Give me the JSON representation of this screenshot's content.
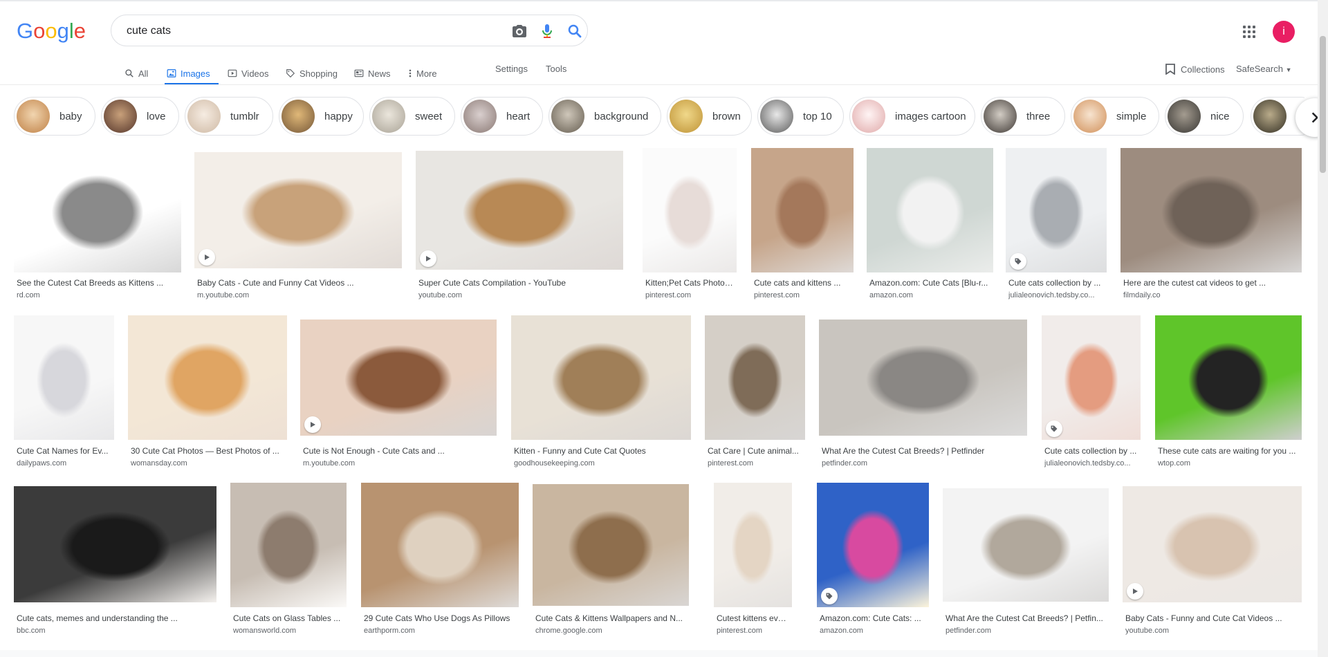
{
  "search": {
    "query": "cute cats",
    "placeholder": ""
  },
  "logo_text": "Google",
  "avatar_letter": "i",
  "tabs": [
    {
      "label": "All",
      "icon": "search-icon"
    },
    {
      "label": "Images",
      "icon": "image-icon"
    },
    {
      "label": "Videos",
      "icon": "video-icon"
    },
    {
      "label": "Shopping",
      "icon": "tag-icon"
    },
    {
      "label": "News",
      "icon": "news-icon"
    },
    {
      "label": "More",
      "icon": "more-vert-icon"
    }
  ],
  "tools": {
    "settings": "Settings",
    "tools": "Tools",
    "collections": "Collections",
    "safesearch": "SafeSearch"
  },
  "chips": [
    "baby",
    "love",
    "tumblr",
    "happy",
    "sweet",
    "heart",
    "background",
    "brown",
    "top 10",
    "images cartoon",
    "three",
    "simple",
    "nice"
  ],
  "results_row1": [
    {
      "title": "See the Cutest Cat Breeds as Kittens ...",
      "source": "rd.com"
    },
    {
      "title": "Baby Cats - Cute and Funny Cat Videos ...",
      "source": "m.youtube.com"
    },
    {
      "title": "Super Cute Cats Compilation - YouTube",
      "source": "youtube.com"
    },
    {
      "title": "Kitten;Pet Cats Photogr...",
      "source": "pinterest.com"
    },
    {
      "title": "Cute cats and kittens ...",
      "source": "pinterest.com"
    },
    {
      "title": "Amazon.com: Cute Cats [Blu-r...",
      "source": "amazon.com"
    },
    {
      "title": "Cute cats collection by ...",
      "source": "julialeonovich.tedsby.co..."
    },
    {
      "title": "Here are the cutest cat videos to get ...",
      "source": "filmdaily.co"
    }
  ],
  "results_row2": [
    {
      "title": "Cute Cat Names for Ev...",
      "source": "dailypaws.com"
    },
    {
      "title": "30 Cute Cat Photos — Best Photos of ...",
      "source": "womansday.com"
    },
    {
      "title": "Cute is Not Enough - Cute Cats and ...",
      "source": "m.youtube.com"
    },
    {
      "title": "Kitten - Funny and Cute Cat Quotes",
      "source": "goodhousekeeping.com"
    },
    {
      "title": "Cat Care | Cute animal...",
      "source": "pinterest.com"
    },
    {
      "title": "What Are the Cutest Cat Breeds? | Petfinder",
      "source": "petfinder.com"
    },
    {
      "title": "Cute cats collection by ...",
      "source": "julialeonovich.tedsby.co..."
    },
    {
      "title": "These cute cats are waiting for you ...",
      "source": "wtop.com"
    }
  ],
  "results_row3": [
    {
      "title": "Cute cats, memes and understanding the ...",
      "source": "bbc.com"
    },
    {
      "title": "Cute Cats on Glass Tables ...",
      "source": "womansworld.com"
    },
    {
      "title": "29 Cute Cats Who Use Dogs As Pillows",
      "source": "earthporm.com"
    },
    {
      "title": "Cute Cats & Kittens Wallpapers and N...",
      "source": "chrome.google.com"
    },
    {
      "title": "Cutest kittens ever, Cut...",
      "source": "pinterest.com"
    },
    {
      "title": "Amazon.com: Cute Cats: ...",
      "source": "amazon.com"
    },
    {
      "title": "What Are the Cutest Cat Breeds? | Petfin...",
      "source": "petfinder.com"
    },
    {
      "title": "Baby Cats - Funny and Cute Cat Videos ...",
      "source": "youtube.com"
    }
  ],
  "colors": {
    "accent": "#1a73e8",
    "avatar": "#e91e63",
    "text": "#202124",
    "muted": "#5f6368"
  }
}
